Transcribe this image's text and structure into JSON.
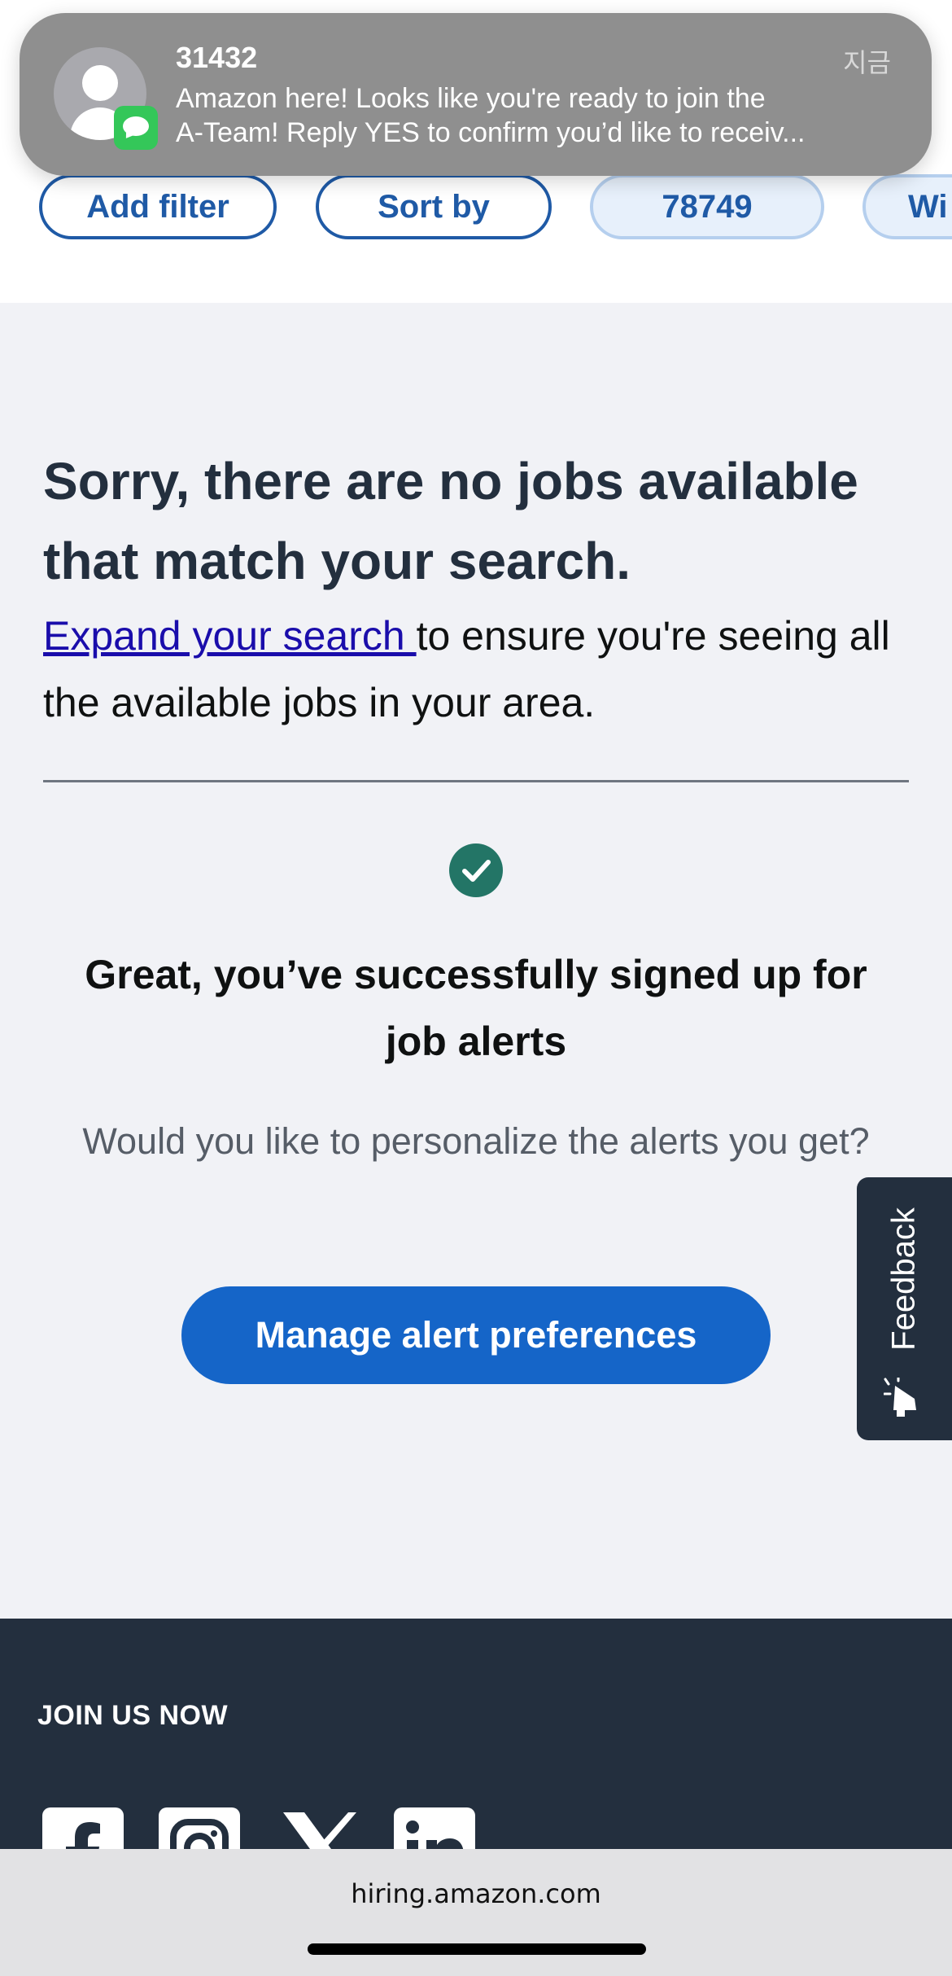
{
  "notification": {
    "sender": "31432",
    "time": "지금",
    "line1": "Amazon here! Looks like you're ready to join the",
    "line2": "A-Team! Reply YES to confirm you’d like to receiv..."
  },
  "filters": {
    "add_filter": "Add filter",
    "sort_by": "Sort by",
    "zip": "78749",
    "within": "Wi"
  },
  "results": {
    "no_jobs_title": "Sorry, there are no jobs available that match your search.",
    "expand_link": "Expand your search ",
    "expand_rest": "to ensure you're seeing all the available jobs in your area."
  },
  "alerts": {
    "success_title": "Great, you’ve successfully signed up for job alerts",
    "personalize_prompt": "Would you like to personalize the alerts you get?",
    "manage_button": "Manage alert preferences"
  },
  "feedback": {
    "label": "Feedback"
  },
  "footer": {
    "join_us": "JOIN US NOW",
    "social": [
      "facebook-icon",
      "instagram-icon",
      "x-icon",
      "linkedin-icon"
    ]
  },
  "browser": {
    "url": "hiring.amazon.com"
  },
  "colors": {
    "accent_blue": "#1565c8",
    "chip_blue": "#1f5aa6",
    "success_green": "#237566",
    "footer_bg": "#232f3e",
    "link": "#1a0dab"
  }
}
